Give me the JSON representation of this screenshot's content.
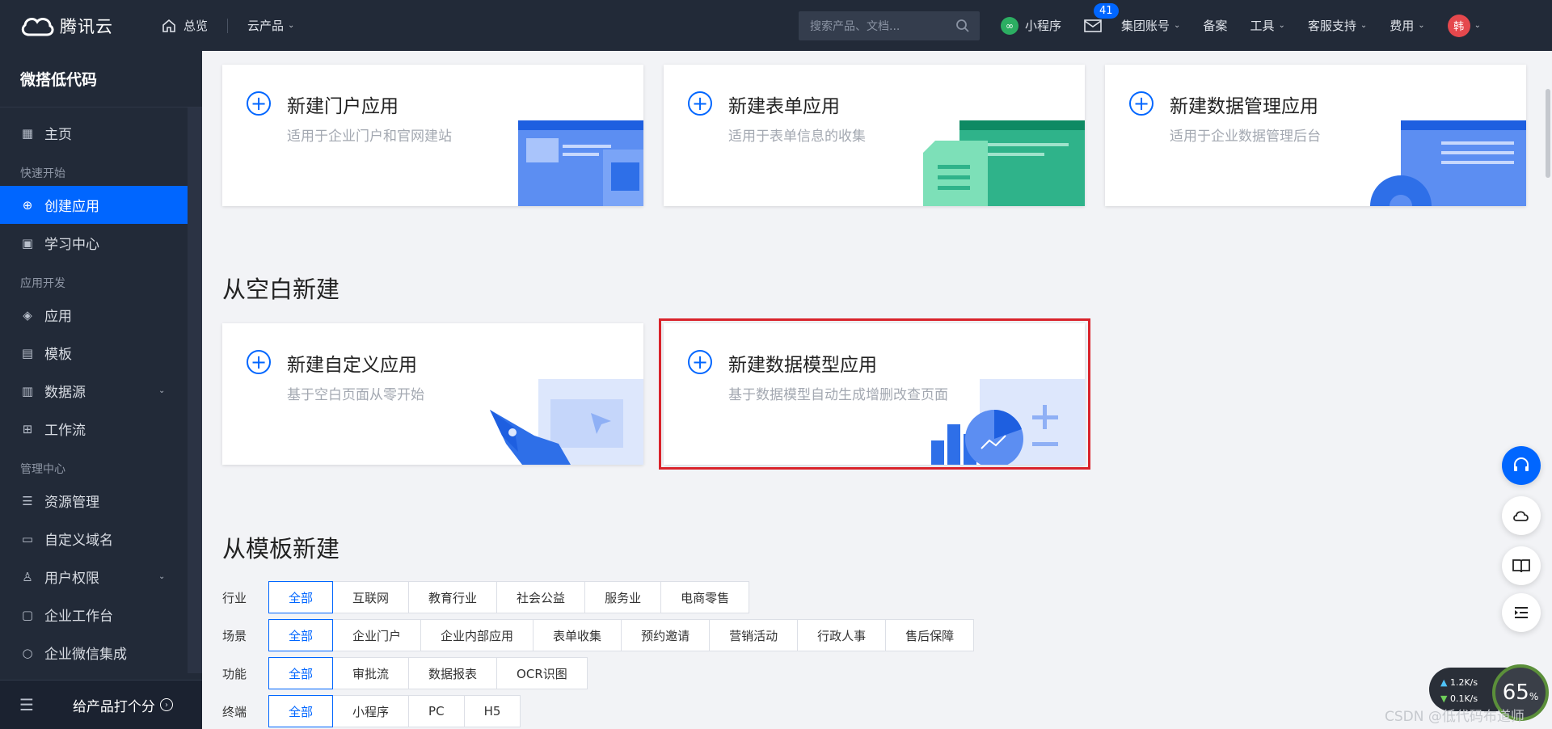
{
  "topbar": {
    "brand": "腾讯云",
    "home": "总览",
    "products": "云产品",
    "search_placeholder": "搜索产品、文档...",
    "mini_program": "小程序",
    "mail_badge": "41",
    "group_account": "集团账号",
    "filing": "备案",
    "tools": "工具",
    "support": "客服支持",
    "billing": "费用",
    "avatar_text": "韩"
  },
  "sidebar": {
    "title": "微搭低代码",
    "home": "主页",
    "group_quick": "快速开始",
    "create_app": "创建应用",
    "learning": "学习中心",
    "group_dev": "应用开发",
    "apps": "应用",
    "templates": "模板",
    "datasource": "数据源",
    "workflow": "工作流",
    "group_admin": "管理中心",
    "resources": "资源管理",
    "custom_domain": "自定义域名",
    "user_perm": "用户权限",
    "enterprise_workbench": "企业工作台",
    "wecom": "企业微信集成",
    "rate": "给产品打个分"
  },
  "cards_top": [
    {
      "title": "新建门户应用",
      "desc": "适用于企业门户和官网建站"
    },
    {
      "title": "新建表单应用",
      "desc": "适用于表单信息的收集"
    },
    {
      "title": "新建数据管理应用",
      "desc": "适用于企业数据管理后台"
    }
  ],
  "section_blank": "从空白新建",
  "cards_blank": [
    {
      "title": "新建自定义应用",
      "desc": "基于空白页面从零开始"
    },
    {
      "title": "新建数据模型应用",
      "desc": "基于数据模型自动生成增删改查页面"
    }
  ],
  "section_template": "从模板新建",
  "filters": {
    "industry": {
      "label": "行业",
      "options": [
        "全部",
        "互联网",
        "教育行业",
        "社会公益",
        "服务业",
        "电商零售"
      ]
    },
    "scene": {
      "label": "场景",
      "options": [
        "全部",
        "企业门户",
        "企业内部应用",
        "表单收集",
        "预约邀请",
        "营销活动",
        "行政人事",
        "售后保障"
      ]
    },
    "feature": {
      "label": "功能",
      "options": [
        "全部",
        "审批流",
        "数据报表",
        "OCR识图"
      ]
    },
    "terminal": {
      "label": "终端",
      "options": [
        "全部",
        "小程序",
        "PC",
        "H5"
      ]
    }
  },
  "netmon": {
    "up": "1.2K/s",
    "down": "0.1K/s",
    "percent": "65",
    "percent_unit": "%"
  },
  "watermark": "CSDN @低代码布道师",
  "colors": {
    "accent": "#0066ff",
    "sidebar_bg": "#222a38",
    "highlight": "#d9232b"
  }
}
